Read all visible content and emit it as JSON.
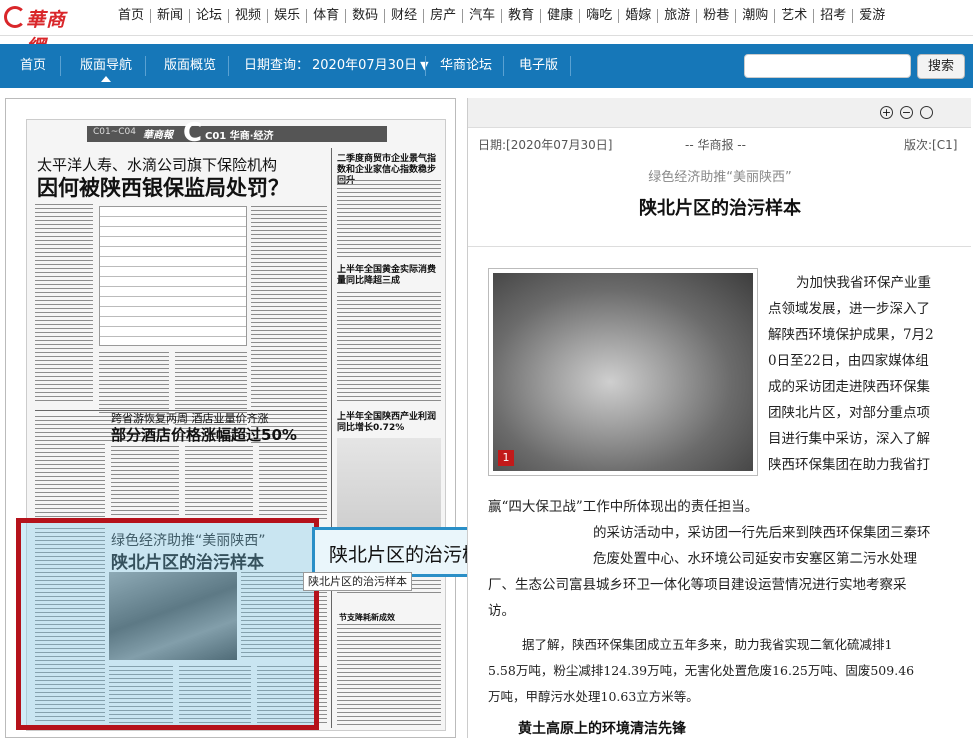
{
  "site": {
    "logo_text": "華商網"
  },
  "top_nav": [
    "首页",
    "新闻",
    "论坛",
    "视频",
    "娱乐",
    "体育",
    "数码",
    "财经",
    "房产",
    "汽车",
    "教育",
    "健康",
    "嗨吃",
    "婚嫁",
    "旅游",
    "粉巷",
    "潮购",
    "艺术",
    "招考",
    "爱游"
  ],
  "blue_nav": {
    "home": "首页",
    "layout_nav": "版面导航",
    "overview": "版面概览",
    "date_label": "日期查询：",
    "date_value": "2020年07月30日",
    "forum": "华商论坛",
    "epaper": "电子版",
    "search_button": "搜索"
  },
  "newspaper": {
    "header": {
      "section_range": "C01~C04",
      "brand": "華商報",
      "page_letter": "C",
      "page_label": "C01 华商·经济"
    },
    "story1": {
      "kicker": "太平洋人寿、水滴公司旗下保险机构",
      "headline": "因何被陕西银保监局处罚？"
    },
    "right_top": {
      "headline": "二季度商贸市企业景气指数和企业家信心指数稳步回升"
    },
    "right_mid": {
      "headline": "上半年全国黄金实际消费量同比降超三成"
    },
    "story2": {
      "kicker": "跨省游恢复两周 酒店业量价齐涨",
      "headline": "部分酒店价格涨幅超过50%"
    },
    "right_low": {
      "headline": "上半年全国陕西产业利润同比增长0.72%"
    },
    "selected": {
      "kicker": "绿色经济助推“美丽陕西”",
      "headline": "陕北片区的治污样本"
    },
    "right_bottom": {
      "label": "节支降耗新成效"
    }
  },
  "tooltip": {
    "big": "陕北片区的治污样本",
    "small": "陕北片区的治污样本"
  },
  "article": {
    "date": "日期:[2020年07月30日]",
    "source": "-- 华商报 --",
    "page": "版次:[C1]",
    "kicker": "绿色经济助推“美丽陕西”",
    "title": "陕北片区的治污样本",
    "photo_number": "1",
    "para1_lines": [
      "为加快我省环保产业重",
      "点领域发展，进一步深入了",
      "解陕西环境保护成果，7月2",
      "0日至22日，由四家媒体组",
      "成的采访团走进陕西环保集",
      "团陕北片区，对部分重点项",
      "目进行集中采访，深入了解",
      "陕西环保集团在助力我省打"
    ],
    "para1_full": "赢“四大保卫战”工作中所体现出的责任担当。",
    "para2_lines": [
      "的采访活动中，采访团一行先后来到陕西环保集团三秦环",
      "危废处置中心、水环境公司延安市安塞区第二污水处理",
      "厂、生态公司富县城乡环卫一体化等项目建设运营情况进行实地考察采",
      "访。"
    ],
    "para3_lines": [
      "据了解，陕西环保集团成立五年多来，助力我省实现二氧化硫减排1",
      "5.58万吨，粉尘减排124.39万吨，无害化处置危废16.25万吨、固废509.46",
      "万吨，甲醇污水处理10.63立方米等。"
    ],
    "sub_heading": "黄土高原上的环境清洁先锋"
  }
}
